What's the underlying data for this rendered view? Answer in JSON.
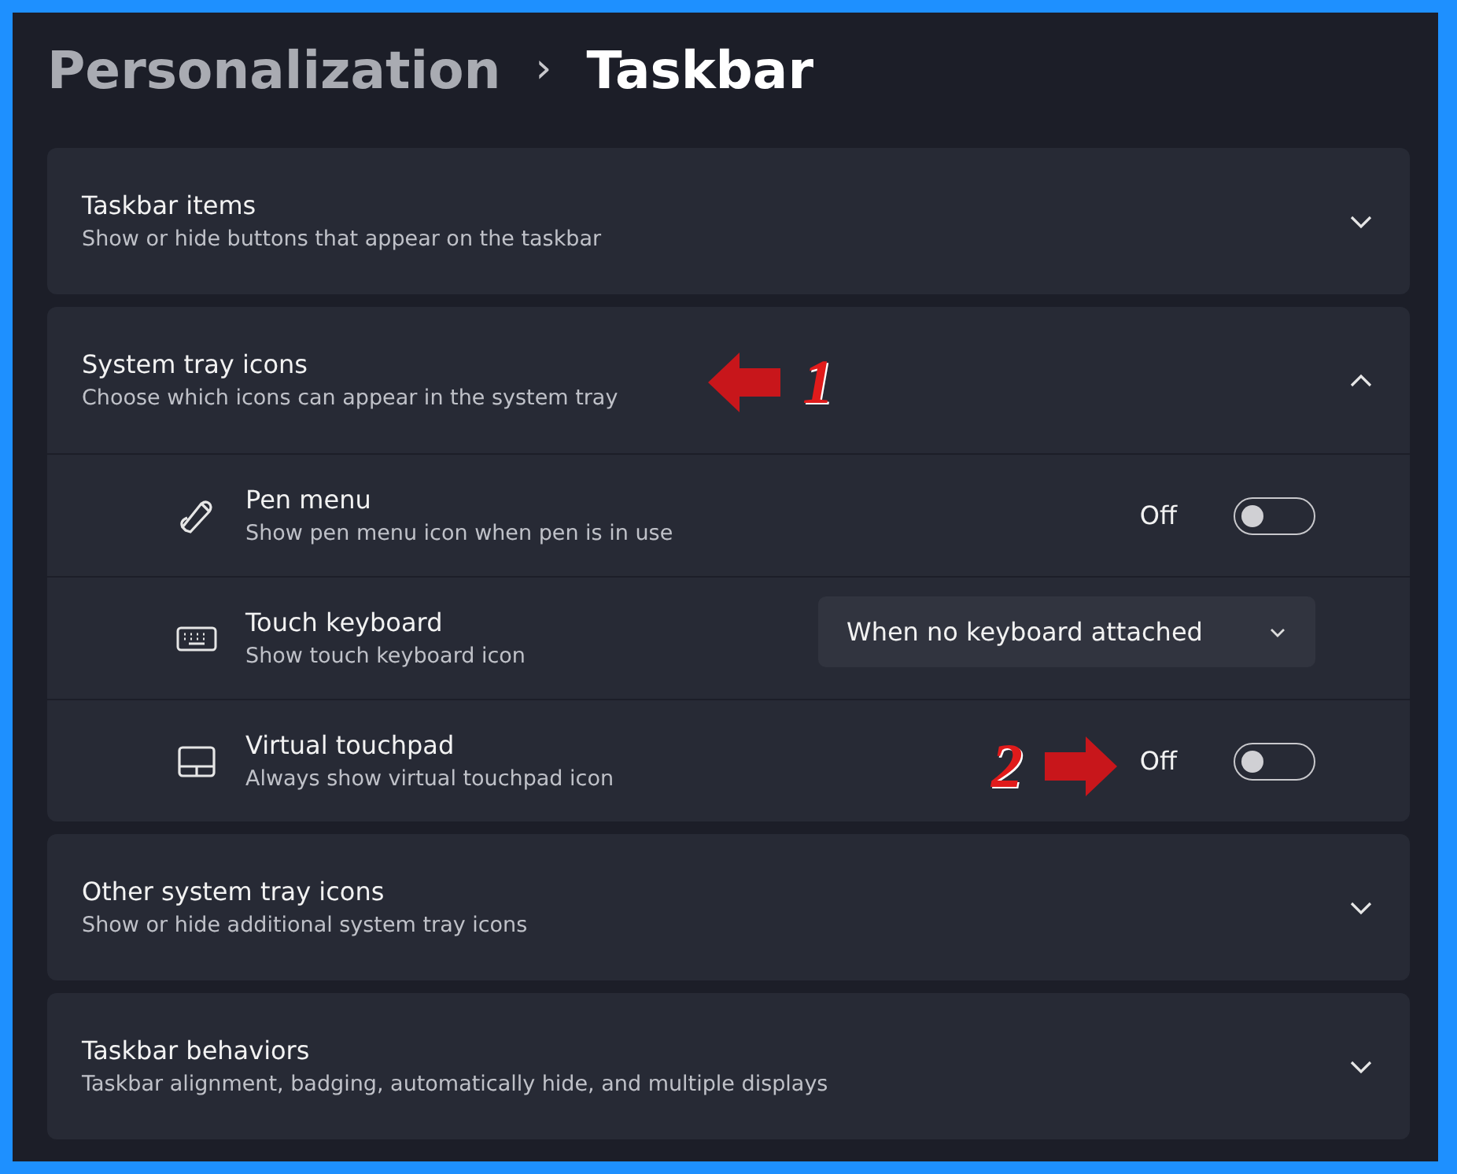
{
  "breadcrumb": {
    "parent": "Personalization",
    "separator": "›",
    "current": "Taskbar"
  },
  "sections": [
    {
      "title": "Taskbar items",
      "subtitle": "Show or hide buttons that appear on the taskbar",
      "expanded": false
    },
    {
      "title": "System tray icons",
      "subtitle": "Choose which icons can appear in the system tray",
      "expanded": true,
      "annotation": {
        "number": "1",
        "kind": "leftarrow"
      },
      "rows": [
        {
          "kind": "toggle",
          "title": "Pen menu",
          "subtitle": "Show pen menu icon when pen is in use",
          "value": "Off",
          "on": false
        },
        {
          "kind": "dropdown",
          "title": "Touch keyboard",
          "subtitle": "Show touch keyboard icon",
          "value": "When no keyboard attached"
        },
        {
          "kind": "toggle",
          "title": "Virtual touchpad",
          "subtitle": "Always show virtual touchpad icon",
          "value": "Off",
          "on": false,
          "annotation": {
            "number": "2",
            "kind": "rightarrow"
          }
        }
      ]
    },
    {
      "title": "Other system tray icons",
      "subtitle": "Show or hide additional system tray icons",
      "expanded": false
    },
    {
      "title": "Taskbar behaviors",
      "subtitle": "Taskbar alignment, badging, automatically hide, and multiple displays",
      "expanded": false
    }
  ]
}
